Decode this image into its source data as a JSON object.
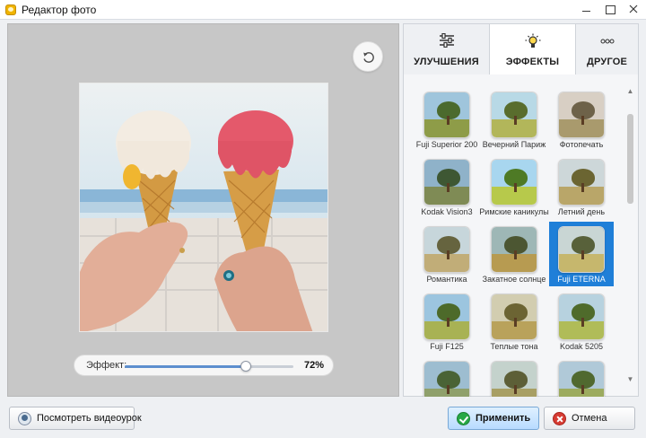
{
  "window": {
    "title": "Редактор фото",
    "minimize_icon": "minimize-icon",
    "maximize_icon": "maximize-icon",
    "close_icon": "close-icon"
  },
  "preview": {
    "rotate_icon": "rotate-icon",
    "effect_label": "Эффект:",
    "effect_percent": 72,
    "effect_value_text": "72%"
  },
  "tabs": [
    {
      "label": "УЛУЧШЕНИЯ",
      "icon": "sliders-icon",
      "active": false
    },
    {
      "label": "ЭФФЕКТЫ",
      "icon": "lightbulb-icon",
      "active": true
    },
    {
      "label": "ДРУГОЕ",
      "icon": "more-icon",
      "active": false
    }
  ],
  "effects": [
    {
      "name": "Fuji Superior 200",
      "sky": "#9fc5dc",
      "ground": "#8e9c48",
      "crown": "#4b6a2d",
      "selected": false
    },
    {
      "name": "Вечерний Париж",
      "sky": "#b8d9e6",
      "ground": "#b2b65a",
      "crown": "#596d2d",
      "selected": false
    },
    {
      "name": "Фотопечать",
      "sky": "#d8cfc4",
      "ground": "#a99a6d",
      "crown": "#6e6249",
      "selected": false
    },
    {
      "name": "Kodak Vision3",
      "sky": "#8fb2c9",
      "ground": "#7f8b55",
      "crown": "#3e5733",
      "selected": false
    },
    {
      "name": "Римские каникулы",
      "sky": "#a8d6ef",
      "ground": "#b7c94b",
      "crown": "#4e7a25",
      "selected": false
    },
    {
      "name": "Летний день",
      "sky": "#cdd7d9",
      "ground": "#b9a669",
      "crown": "#6b6532",
      "selected": false
    },
    {
      "name": "Романтика",
      "sky": "#c7d6db",
      "ground": "#c1ad78",
      "crown": "#66643f",
      "selected": false
    },
    {
      "name": "Закатное солнце",
      "sky": "#9eb7b6",
      "ground": "#b79b51",
      "crown": "#4c5632",
      "selected": false
    },
    {
      "name": "Fuji ETERNA",
      "sky": "#c9d6d4",
      "ground": "#c6b76d",
      "crown": "#58613a",
      "selected": true
    },
    {
      "name": "Fuji F125",
      "sky": "#9cc5df",
      "ground": "#a8b254",
      "crown": "#4d6a2a",
      "selected": false
    },
    {
      "name": "Теплые тона",
      "sky": "#d2cdb0",
      "ground": "#b9a25b",
      "crown": "#6c6433",
      "selected": false
    },
    {
      "name": "Kodak 5205",
      "sky": "#b7d2df",
      "ground": "#b0bc58",
      "crown": "#4f6b2b",
      "selected": false
    },
    {
      "name": "",
      "sky": "#9dbdd0",
      "ground": "#8fa06b",
      "crown": "#4a6335",
      "selected": false
    },
    {
      "name": "",
      "sky": "#c4d2cc",
      "ground": "#a89f64",
      "crown": "#5d5f37",
      "selected": false
    },
    {
      "name": "",
      "sky": "#b0c9d8",
      "ground": "#9cab5f",
      "crown": "#50692f",
      "selected": false
    }
  ],
  "buttons": {
    "video": "Посмотреть видеоурок",
    "apply": "Применить",
    "cancel": "Отмена"
  },
  "colors": {
    "accent": "#1f7fd8",
    "apply_bg": "#b8dbff",
    "slider_fill": "#5d8fce"
  }
}
